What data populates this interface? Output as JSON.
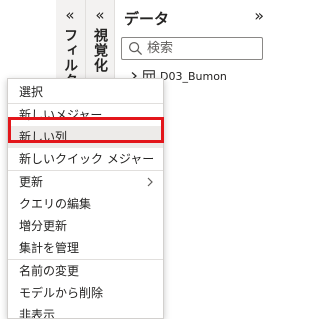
{
  "panes": {
    "filters": {
      "collapse_glyph": "«",
      "title": "フィルター"
    },
    "visualizations": {
      "collapse_glyph": "«",
      "title": "視覚化"
    },
    "data": {
      "title": "データ",
      "expand_glyph": "»",
      "search": {
        "placeholder": "検索",
        "value": ""
      },
      "tables": [
        {
          "name": "D03_Bumon",
          "icon": "table-icon"
        }
      ]
    }
  },
  "context_menu": {
    "items": [
      {
        "label": "選択"
      },
      {
        "label": "新しいメジャー"
      },
      {
        "label": "新しい列",
        "highlighted": true
      },
      {
        "label": "新しいクイック メジャー"
      },
      {
        "label": "更新",
        "has_submenu": true
      },
      {
        "label": "クエリの編集"
      },
      {
        "label": "増分更新"
      },
      {
        "label": "集計を管理"
      },
      {
        "label": "名前の変更"
      },
      {
        "label": "モデルから削除"
      },
      {
        "label": "非表示"
      }
    ]
  },
  "colors": {
    "highlight_outline": "#e3161b",
    "pane_background": "#f3f2f1",
    "menu_hover": "#edebe9"
  }
}
